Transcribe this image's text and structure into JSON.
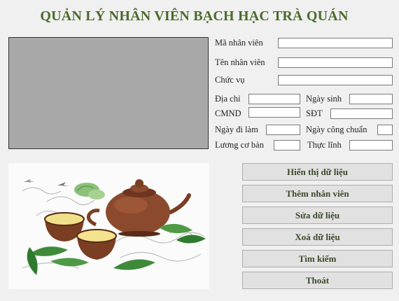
{
  "title": "QUẢN LÝ NHÂN VIÊN BẠCH HẠC TRÀ QUÁN",
  "form": {
    "ma_nv": {
      "label": "Mã nhân viên",
      "value": ""
    },
    "ten_nv": {
      "label": "Tên nhân viên",
      "value": ""
    },
    "chuc_vu": {
      "label": "Chức vụ",
      "value": ""
    },
    "dia_chi": {
      "label": "Địa chỉ",
      "value": ""
    },
    "ngay_sinh": {
      "label": "Ngày sinh",
      "value": ""
    },
    "cmnd": {
      "label": "CMND",
      "value": ""
    },
    "sdt": {
      "label": "SĐT",
      "value": ""
    },
    "ngay_di_lam": {
      "label": "Ngày đi làm",
      "value": ""
    },
    "ngay_cong_chuan": {
      "label": "Ngày công chuẩn",
      "value": ""
    },
    "luong_co_ban": {
      "label": "Lương cơ bản",
      "value": ""
    },
    "thuc_linh": {
      "label": "Thực lĩnh",
      "value": ""
    }
  },
  "buttons": {
    "hien_thi": "Hiển thị dữ liệu",
    "them": "Thêm nhân viên",
    "sua": "Sửa dữ liệu",
    "xoa": "Xoá dữ liệu",
    "tim_kiem": "Tìm kiếm",
    "thoat": "Thoát"
  },
  "colors": {
    "title": "#4a6a2a",
    "photo_placeholder": "#a8a8a8",
    "button_bg": "#e1e1e1",
    "teapot": "#8b4a2e"
  },
  "illustration": "tea-set-image"
}
